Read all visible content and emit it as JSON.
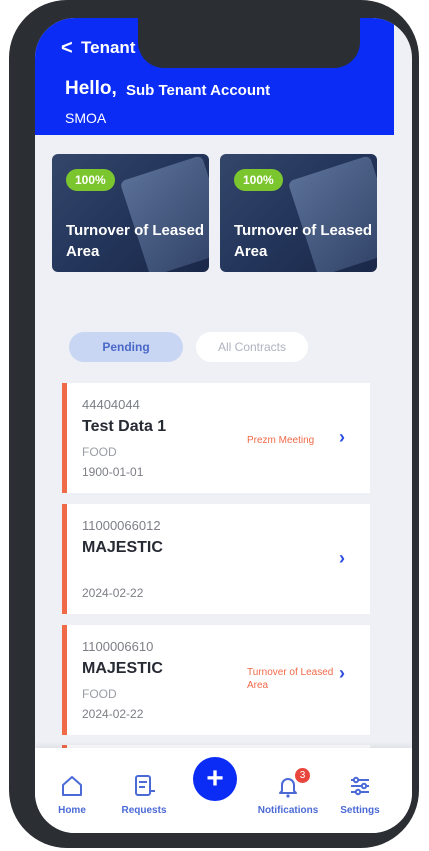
{
  "header": {
    "back_glyph": "<",
    "title": "Tenant Portal",
    "greeting": "Hello,",
    "account_name": "Sub Tenant Account",
    "company": "SMOA"
  },
  "banners": [
    {
      "percent": "100%",
      "caption": "Turnover of Leased Area"
    },
    {
      "percent": "100%",
      "caption": "Turnover of Leased Area"
    }
  ],
  "tabs": [
    {
      "label": "Pending",
      "active": true
    },
    {
      "label": "All Contracts",
      "active": false
    }
  ],
  "contracts": [
    {
      "code": "44404044",
      "title": "Test Data 1",
      "category": "FOOD",
      "date": "1900-01-01",
      "status": "Prezm Meeting"
    },
    {
      "code": "11000066012",
      "title": "MAJESTIC",
      "category": "",
      "date": "2024-02-22",
      "status": ""
    },
    {
      "code": "1100006610",
      "title": "MAJESTIC",
      "category": "FOOD",
      "date": "2024-02-22",
      "status": "Turnover of Leased Area"
    }
  ],
  "bottom_nav": [
    {
      "label": "Home",
      "icon": "home-icon"
    },
    {
      "label": "Requests",
      "icon": "requests-icon"
    },
    {
      "label": "",
      "icon": "plus-icon"
    },
    {
      "label": "Notifications",
      "icon": "bell-icon",
      "badge": "3"
    },
    {
      "label": "Settings",
      "icon": "sliders-icon"
    }
  ],
  "colors": {
    "brand_blue": "#0a2cf5",
    "accent_orange": "#f06a48",
    "badge_green": "#7bc62e",
    "nav_blue": "#4b6ad6"
  }
}
